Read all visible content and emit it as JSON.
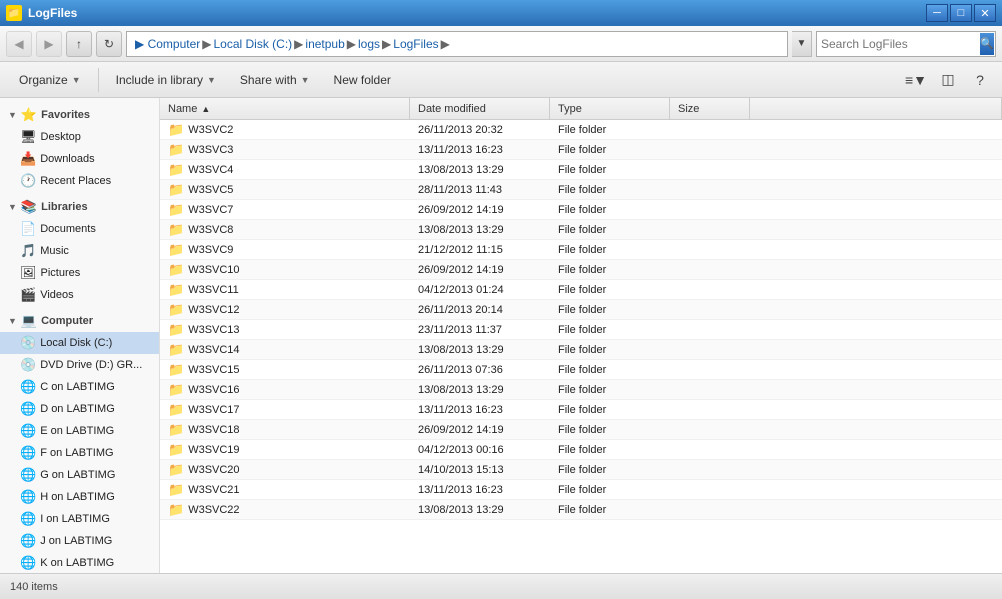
{
  "titleBar": {
    "title": "LogFiles",
    "icon": "📁",
    "controls": {
      "minimize": "─",
      "maximize": "□",
      "close": "✕"
    }
  },
  "addressBar": {
    "back_disabled": true,
    "forward_disabled": true,
    "path_parts": [
      "Computer",
      "Local Disk (C:)",
      "inetpub",
      "logs",
      "LogFiles"
    ],
    "search_placeholder": "Search LogFiles",
    "dropdown_arrow": "▼",
    "search_icon": "🔍"
  },
  "toolbar": {
    "organize_label": "Organize",
    "include_library_label": "Include in library",
    "share_with_label": "Share with",
    "new_folder_label": "New folder",
    "arrow": "▼",
    "view_icon": "≡",
    "preview_icon": "□",
    "help_icon": "?"
  },
  "sidebar": {
    "favorites_header": "Favorites",
    "favorites_items": [
      {
        "label": "Desktop",
        "icon": "🖥"
      },
      {
        "label": "Downloads",
        "icon": "📥"
      },
      {
        "label": "Recent Places",
        "icon": "🕐"
      }
    ],
    "libraries_header": "Libraries",
    "libraries_items": [
      {
        "label": "Documents",
        "icon": "📄"
      },
      {
        "label": "Music",
        "icon": "🎵"
      },
      {
        "label": "Pictures",
        "icon": "🖼"
      },
      {
        "label": "Videos",
        "icon": "🎬"
      }
    ],
    "computer_header": "Computer",
    "computer_items": [
      {
        "label": "Local Disk (C:)",
        "icon": "💿",
        "active": true
      },
      {
        "label": "DVD Drive (D:) GR...",
        "icon": "💿"
      },
      {
        "label": "C on LABTIMG",
        "icon": "🌐"
      },
      {
        "label": "D on LABTIMG",
        "icon": "🌐"
      },
      {
        "label": "E on LABTIMG",
        "icon": "🌐"
      },
      {
        "label": "F on LABTIMG",
        "icon": "🌐"
      },
      {
        "label": "G on LABTIMG",
        "icon": "🌐"
      },
      {
        "label": "H on LABTIMG",
        "icon": "🌐"
      },
      {
        "label": "I on LABTIMG",
        "icon": "🌐"
      },
      {
        "label": "J on LABTIMG",
        "icon": "🌐"
      },
      {
        "label": "K on LABTIMG",
        "icon": "🌐"
      }
    ]
  },
  "fileList": {
    "columns": [
      {
        "label": "Name",
        "sort_arrow": "▲",
        "key": "name"
      },
      {
        "label": "Date modified",
        "key": "date"
      },
      {
        "label": "Type",
        "key": "type"
      },
      {
        "label": "Size",
        "key": "size"
      }
    ],
    "rows": [
      {
        "name": "W3SVC2",
        "date": "26/11/2013 20:32",
        "type": "File folder",
        "size": ""
      },
      {
        "name": "W3SVC3",
        "date": "13/11/2013 16:23",
        "type": "File folder",
        "size": ""
      },
      {
        "name": "W3SVC4",
        "date": "13/08/2013 13:29",
        "type": "File folder",
        "size": ""
      },
      {
        "name": "W3SVC5",
        "date": "28/11/2013 11:43",
        "type": "File folder",
        "size": ""
      },
      {
        "name": "W3SVC7",
        "date": "26/09/2012 14:19",
        "type": "File folder",
        "size": ""
      },
      {
        "name": "W3SVC8",
        "date": "13/08/2013 13:29",
        "type": "File folder",
        "size": ""
      },
      {
        "name": "W3SVC9",
        "date": "21/12/2012 11:15",
        "type": "File folder",
        "size": ""
      },
      {
        "name": "W3SVC10",
        "date": "26/09/2012 14:19",
        "type": "File folder",
        "size": ""
      },
      {
        "name": "W3SVC11",
        "date": "04/12/2013 01:24",
        "type": "File folder",
        "size": ""
      },
      {
        "name": "W3SVC12",
        "date": "26/11/2013 20:14",
        "type": "File folder",
        "size": ""
      },
      {
        "name": "W3SVC13",
        "date": "23/11/2013 11:37",
        "type": "File folder",
        "size": ""
      },
      {
        "name": "W3SVC14",
        "date": "13/08/2013 13:29",
        "type": "File folder",
        "size": ""
      },
      {
        "name": "W3SVC15",
        "date": "26/11/2013 07:36",
        "type": "File folder",
        "size": ""
      },
      {
        "name": "W3SVC16",
        "date": "13/08/2013 13:29",
        "type": "File folder",
        "size": ""
      },
      {
        "name": "W3SVC17",
        "date": "13/11/2013 16:23",
        "type": "File folder",
        "size": ""
      },
      {
        "name": "W3SVC18",
        "date": "26/09/2012 14:19",
        "type": "File folder",
        "size": ""
      },
      {
        "name": "W3SVC19",
        "date": "04/12/2013 00:16",
        "type": "File folder",
        "size": ""
      },
      {
        "name": "W3SVC20",
        "date": "14/10/2013 15:13",
        "type": "File folder",
        "size": ""
      },
      {
        "name": "W3SVC21",
        "date": "13/11/2013 16:23",
        "type": "File folder",
        "size": ""
      },
      {
        "name": "W3SVC22",
        "date": "13/08/2013 13:29",
        "type": "File folder",
        "size": ""
      }
    ]
  },
  "statusBar": {
    "item_count": "140 items"
  }
}
